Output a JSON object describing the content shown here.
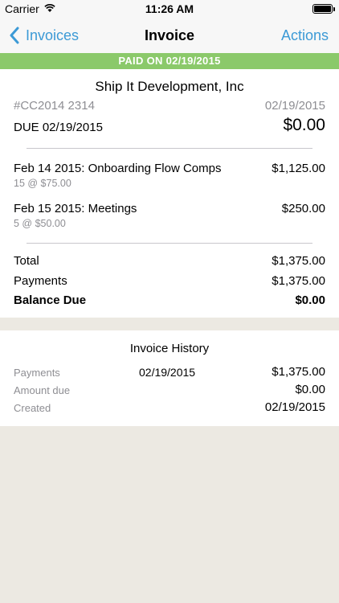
{
  "status_bar": {
    "carrier": "Carrier",
    "time": "11:26 AM",
    "battery_level": 1.0
  },
  "nav": {
    "back_label": "Invoices",
    "title": "Invoice",
    "actions_label": "Actions"
  },
  "banner": {
    "text": "PAID ON 02/19/2015",
    "color": "#8bc96a"
  },
  "invoice": {
    "company": "Ship It Development, Inc",
    "number": "#CC2014 2314",
    "date": "02/19/2015",
    "due_label": "DUE 02/19/2015",
    "due_amount": "$0.00"
  },
  "line_items": [
    {
      "description": "Feb 14 2015: Onboarding Flow Comps",
      "detail": "15 @ $75.00",
      "amount": "$1,125.00"
    },
    {
      "description": "Feb 15 2015: Meetings",
      "detail": "5 @ $50.00",
      "amount": "$250.00"
    }
  ],
  "summary": {
    "total_label": "Total",
    "total": "$1,375.00",
    "payments_label": "Payments",
    "payments": "$1,375.00",
    "balance_label": "Balance Due",
    "balance": "$0.00"
  },
  "history": {
    "title": "Invoice History",
    "rows": [
      {
        "label": "Payments",
        "date": "02/19/2015",
        "value": "$1,375.00"
      },
      {
        "label": "Amount due",
        "date": "",
        "value": "$0.00"
      },
      {
        "label": "Created",
        "date": "",
        "value": "02/19/2015"
      }
    ]
  },
  "colors": {
    "accent": "#3c9ad6",
    "background": "#ece9e2",
    "muted_text": "#8e8e93"
  }
}
